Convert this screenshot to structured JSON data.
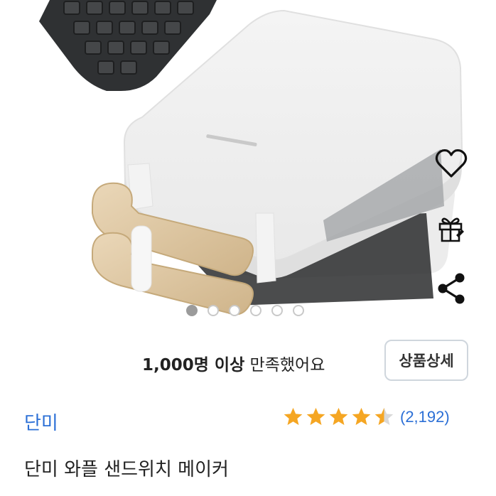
{
  "product": {
    "satisfaction_bold": "1,000명 이상",
    "satisfaction_rest": " 만족했어요",
    "detail_button": "상품상세",
    "brand": "단미",
    "rating": {
      "value": 4.5,
      "max": 5,
      "count": "(2,192)"
    },
    "title": "단미 와플 샌드위치 메이커"
  },
  "gallery": {
    "total": 6,
    "current": 1
  },
  "icons": {
    "like": "heart-icon",
    "gift": "gift-icon",
    "share": "share-icon"
  },
  "colors": {
    "brand": "#2b6fd6",
    "star": "#f5a623",
    "dot_active": "#9b9b9b"
  }
}
